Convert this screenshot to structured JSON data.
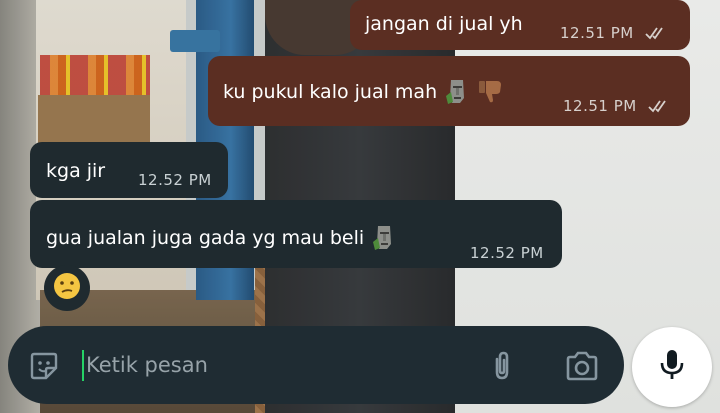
{
  "messages": [
    {
      "direction": "outgoing",
      "text": "jangan di jual yh",
      "time": "12.51 PM",
      "status": "read",
      "emoji": []
    },
    {
      "direction": "outgoing",
      "text": "ku pukul kalo jual mah",
      "time": "12.51 PM",
      "status": "read",
      "emoji": [
        "moai-emoji",
        "thumbs-down-emoji"
      ]
    },
    {
      "direction": "incoming",
      "text": "kga jir",
      "time": "12.52 PM"
    },
    {
      "direction": "incoming",
      "text": "gua jualan juga gada yg mau beli",
      "time": "12.52 PM",
      "emoji": [
        "moai-emoji"
      ]
    }
  ],
  "reaction": {
    "icon": "confused-face-emoji"
  },
  "composer": {
    "placeholder": "Ketik pesan",
    "icons": [
      "sticker-icon",
      "paperclip-icon",
      "camera-icon"
    ]
  },
  "mic": {
    "icon": "microphone-icon"
  },
  "colors": {
    "outgoing_bubble": "#5b2e22",
    "incoming_bubble": "#1f2a2f",
    "input_bar": "#1f2c33",
    "caret": "#25d366"
  }
}
